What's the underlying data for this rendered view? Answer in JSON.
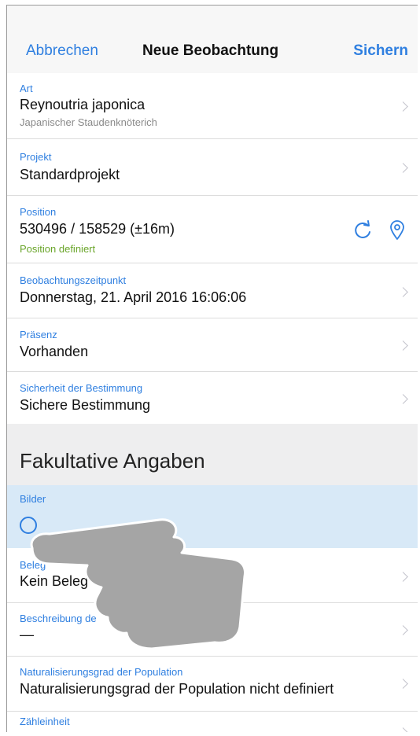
{
  "nav": {
    "cancel": "Abbrechen",
    "title": "Neue Beobachtung",
    "save": "Sichern"
  },
  "rows": {
    "art": {
      "label": "Art",
      "value": "Reynoutria japonica",
      "sub": "Japanischer Staudenknöterich"
    },
    "projekt": {
      "label": "Projekt",
      "value": "Standardprojekt"
    },
    "position": {
      "label": "Position",
      "value": "530496 / 158529 (±16m)",
      "status": "Position definiert"
    },
    "zeitpunkt": {
      "label": "Beobachtungszeitpunkt",
      "value": "Donnerstag, 21. April 2016 16:06:06"
    },
    "praesenz": {
      "label": "Präsenz",
      "value": "Vorhanden"
    },
    "sicherheit": {
      "label": "Sicherheit der Bestimmung",
      "value": "Sichere Bestimmung"
    }
  },
  "section": {
    "title": "Fakultative Angaben"
  },
  "optional": {
    "bilder": {
      "label": "Bilder"
    },
    "beleg": {
      "label": "Beleg",
      "value": "Kein Beleg"
    },
    "beschreibung": {
      "label": "Beschreibung de",
      "value": "—"
    },
    "naturalisierung": {
      "label": "Naturalisierungsgrad der Population",
      "value": "Naturalisierungsgrad der Population nicht definiert"
    },
    "zaehleinheit": {
      "label": "Zähleinheit"
    }
  },
  "icons": {
    "refresh": "refresh-icon",
    "location": "location-pin-icon",
    "chevron": "chevron-right-icon",
    "add_photo": "add-circle-icon"
  },
  "colors": {
    "accent": "#2f7fe0",
    "status_ok": "#6aa52a",
    "selected_row": "#d8e9f7"
  }
}
